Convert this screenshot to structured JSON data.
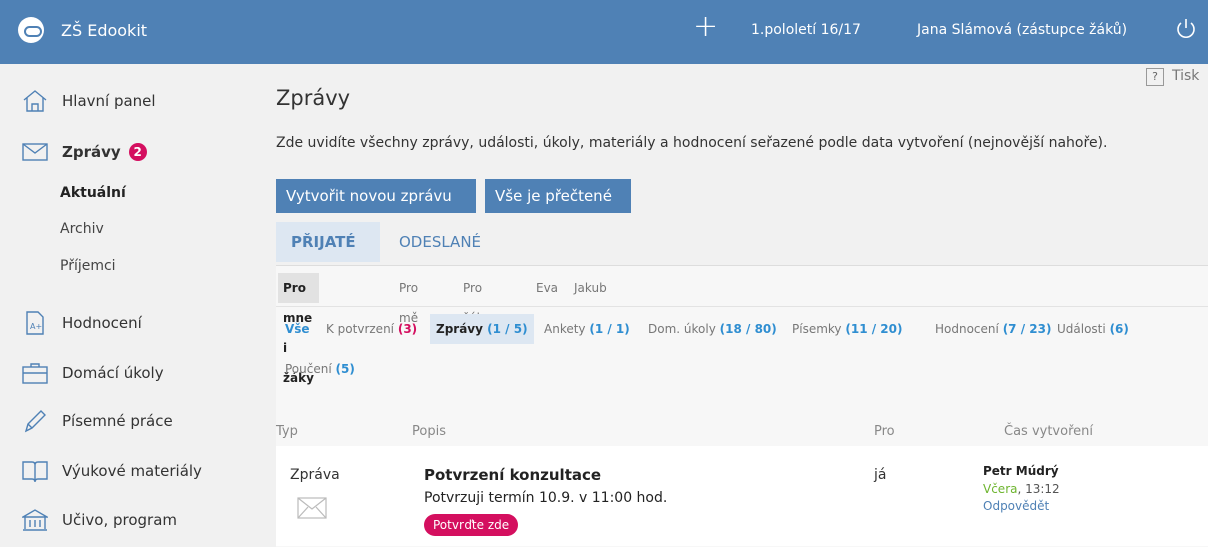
{
  "header": {
    "app_title": "ZŠ Edookit",
    "add_icon": "plus-icon",
    "period": "1.pololetí 16/17",
    "user": "Jana Slámová (zástupce žáků)",
    "logout_icon": "power-icon",
    "color": "#4f81b5"
  },
  "sidebar": {
    "items": [
      {
        "label": "Hlavní panel",
        "icon": "home-icon"
      },
      {
        "label": "Zprávy",
        "icon": "envelope-icon",
        "badge": "2"
      },
      {
        "label": "Hodnocení",
        "icon": "grade-document-icon"
      },
      {
        "label": "Domácí úkoly",
        "icon": "briefcase-icon"
      },
      {
        "label": "Písemné práce",
        "icon": "pencil-icon"
      },
      {
        "label": "Výukové materiály",
        "icon": "book-icon"
      },
      {
        "label": "Učivo, program",
        "icon": "building-icon"
      }
    ],
    "subitems": [
      "Aktuální",
      "Archiv",
      "Příjemci"
    ]
  },
  "page": {
    "help_label": "?",
    "print_label": "Tisk",
    "title": "Zprávy",
    "description": "Zde uvidíte všechny zprávy, události, úkoly, materiály a hodnocení seřazené podle data vytvoření (nejnovější nahoře).",
    "new_message_button": "Vytvořit novou zprávu",
    "all_read_button": "Vše je přečtené",
    "tabs": [
      "PŘIJATÉ",
      "ODESLANÉ"
    ]
  },
  "filters_people": [
    "Pro mne i žáky",
    "Pro mě",
    "Pro žáky",
    "Eva",
    "Jakub"
  ],
  "filters_types": [
    {
      "label": "Vše",
      "count": ""
    },
    {
      "label": "K potvrzení",
      "count": "(3)"
    },
    {
      "label": "Zprávy",
      "count": "(1 / 5)"
    },
    {
      "label": "Ankety",
      "count": "(1 / 1)"
    },
    {
      "label": "Dom. úkoly",
      "count": "(18 / 80)"
    },
    {
      "label": "Písemky",
      "count": "(11 / 20)"
    },
    {
      "label": "Hodnocení",
      "count": "(7 / 23)"
    },
    {
      "label": "Události",
      "count": "(6)"
    },
    {
      "label": "Poučení",
      "count": "(5)"
    }
  ],
  "table": {
    "headers": [
      "Typ",
      "Popis",
      "Pro",
      "Čas vytvoření"
    ],
    "rows": [
      {
        "type": "Zpráva",
        "subject": "Potvrzení konzultace",
        "text": "Potvrzuji termín 10.9. v 11:00 hod.",
        "confirm_button": "Potvrďte zde",
        "to": "já",
        "author": "Petr Múdrý",
        "day": "Včera",
        "time": ", 13:12",
        "reply": "Odpovědět"
      }
    ]
  }
}
